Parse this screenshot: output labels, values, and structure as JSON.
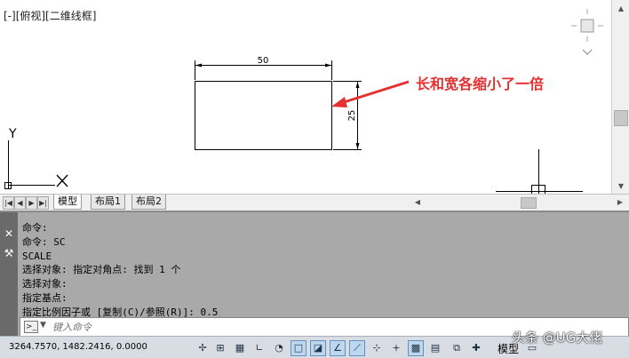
{
  "viewport": {
    "view_label": "[-][俯视][二维线框]",
    "dimension_top": "50",
    "dimension_right": "25",
    "annotation": "长和宽各缩小了一倍",
    "ucs_y": "Y"
  },
  "tabs": {
    "items": [
      {
        "label": "模型"
      },
      {
        "label": "布局1"
      },
      {
        "label": "布局2"
      }
    ]
  },
  "command": {
    "history": [
      "命令:",
      "命令: SC",
      "SCALE",
      "选择对象: 指定对角点: 找到 1 个",
      "选择对象:",
      "指定基点:",
      "指定比例因子或 [复制(C)/参照(R)]: 0.5"
    ],
    "input_placeholder": "键入命令"
  },
  "statusbar": {
    "coordinates": "3264.7570, 1482.2416, 0.0000",
    "model_label": "模型"
  },
  "watermark": "头条 @UG大佬",
  "colors": {
    "annotation": "#e53030",
    "command_bg": "#a9a9a9",
    "status_bg": "#d8dde4"
  }
}
